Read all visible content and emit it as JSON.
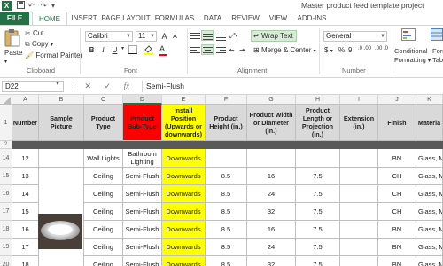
{
  "titlebar": {
    "logo": "X",
    "quick_access": {
      "save_icon": "save-icon",
      "undo_glyph": "↶",
      "redo_glyph": "↷"
    },
    "title": "Master product feed template project"
  },
  "ribbon_tabs": [
    "FILE",
    "HOME",
    "INSERT",
    "PAGE LAYOUT",
    "FORMULAS",
    "DATA",
    "REVIEW",
    "VIEW",
    "ADD-INS"
  ],
  "active_tab": "HOME",
  "clipboard": {
    "paste": "Paste",
    "cut": "Cut",
    "copy": "Copy",
    "format_painter": "Format Painter",
    "label": "Clipboard"
  },
  "font": {
    "name": "Calibri",
    "size": "11",
    "bold": "B",
    "italic": "I",
    "underline": "U",
    "grow": "A",
    "shrink": "A",
    "label": "Font",
    "font_color": "#ff0000"
  },
  "alignment": {
    "wrap_text": "Wrap Text",
    "merge_center": "Merge & Center",
    "label": "Alignment"
  },
  "number": {
    "format": "General",
    "currency": "$",
    "percent": "%",
    "comma": "9",
    "inc_dec": ".0 .00",
    "dec_dec": ".00 .0",
    "label": "Number"
  },
  "styles": {
    "conditional": "Conditional",
    "conditional_2": "Formatting",
    "format_as": "Format",
    "format_as_2": "Table"
  },
  "formula_bar": {
    "name_box": "D22",
    "fx": "fx",
    "formula": "Semi-Flush"
  },
  "columns": [
    "A",
    "B",
    "C",
    "D",
    "E",
    "F",
    "G",
    "H",
    "I",
    "J",
    "K"
  ],
  "header_row": {
    "row_num": "1",
    "cells": [
      "Number",
      "Sample Picture",
      "Product Type",
      "Product Sub-Type",
      "Install Position (Upwards or downwards)",
      "Product Height (in.)",
      "Product Width or Diameter (in.)",
      "Product Length or Projection (in.)",
      "Extension (in.)",
      "Finish",
      "Materia"
    ]
  },
  "row2_num": "2",
  "rows": [
    {
      "row_num": "14",
      "cells": [
        "12",
        "",
        "Wall Lights",
        "Bathroom Lighting",
        "Downwards",
        "",
        "",
        "",
        "",
        "BN",
        "Glass, Me"
      ]
    },
    {
      "row_num": "15",
      "cells": [
        "13",
        "",
        "Ceiling",
        "Semi-Flush",
        "Downwards",
        "8.5",
        "16",
        "7.5",
        "",
        "CH",
        "Glass, Me"
      ]
    },
    {
      "row_num": "16",
      "cells": [
        "14",
        "",
        "Ceiling",
        "Semi-Flush",
        "Downwards",
        "8.5",
        "24",
        "7.5",
        "",
        "CH",
        "Glass, Me"
      ]
    },
    {
      "row_num": "17",
      "cells": [
        "15",
        "",
        "Ceiling",
        "Semi-Flush",
        "Downwards",
        "8.5",
        "32",
        "7.5",
        "",
        "CH",
        "Glass, Me"
      ]
    },
    {
      "row_num": "18",
      "cells": [
        "16",
        "",
        "Ceiling",
        "Semi-Flush",
        "Downwards",
        "8.5",
        "16",
        "7.5",
        "",
        "BN",
        "Glass, Me"
      ]
    },
    {
      "row_num": "19",
      "cells": [
        "17",
        "",
        "Ceiling",
        "Semi-Flush",
        "Downwards",
        "8.5",
        "24",
        "7.5",
        "",
        "BN",
        "Glass, Me"
      ]
    },
    {
      "row_num": "20",
      "cells": [
        "18",
        "",
        "Ceiling",
        "Semi-Flush",
        "Downwards",
        "8.5",
        "32",
        "7.5",
        "",
        "BN",
        "Glass, Me"
      ]
    }
  ],
  "colors": {
    "excel_green": "#217346",
    "header_red": "#ff0000",
    "install_yellow": "#ffff00",
    "header_gray": "#d9d9d9"
  }
}
